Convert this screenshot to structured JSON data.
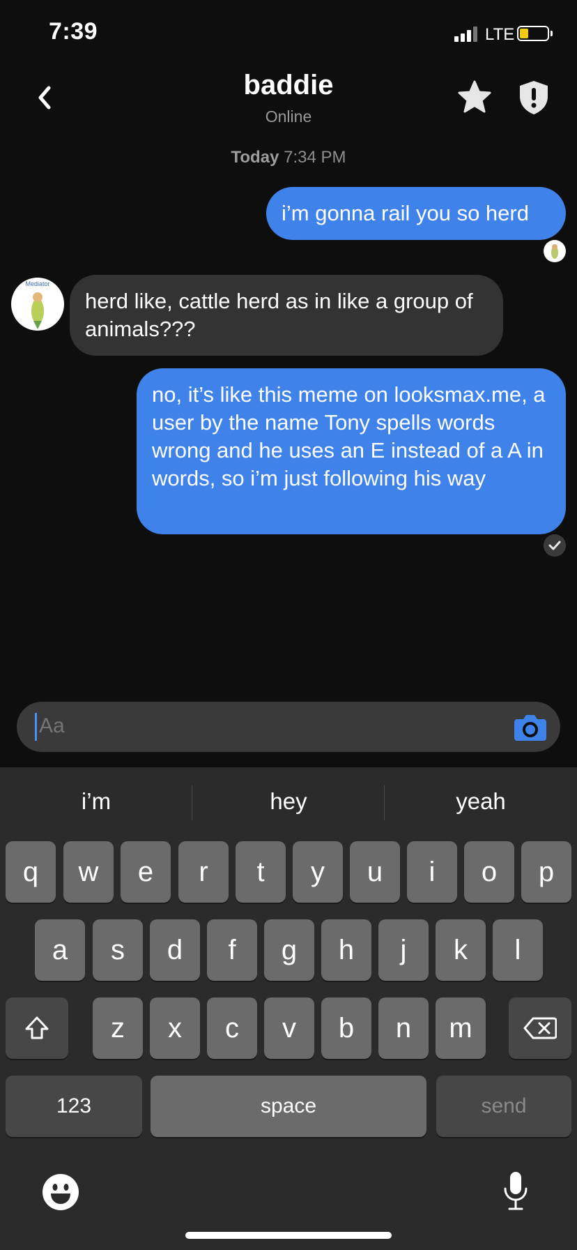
{
  "status_bar": {
    "time": "7:39",
    "network": "LTE"
  },
  "header": {
    "name": "baddie",
    "status": "Online"
  },
  "conversation": {
    "timestamp_day": "Today",
    "timestamp_time": "7:34 PM",
    "messages": [
      {
        "direction": "outgoing",
        "text": "i’m gonna rail you so herd"
      },
      {
        "direction": "incoming",
        "text": "herd like, cattle herd as in like a group of animals???"
      },
      {
        "direction": "outgoing",
        "text": "no, it’s like this meme on looksmax.me, a user by the name Tony spells words wrong and he uses an E instead of a A in words, so i’m just following his way"
      }
    ],
    "avatar_caption": "Mediator"
  },
  "composer": {
    "placeholder": "Aa"
  },
  "keyboard": {
    "suggestions": [
      "i’m",
      "hey",
      "yeah"
    ],
    "row1": [
      "q",
      "w",
      "e",
      "r",
      "t",
      "y",
      "u",
      "i",
      "o",
      "p"
    ],
    "row2": [
      "a",
      "s",
      "d",
      "f",
      "g",
      "h",
      "j",
      "k",
      "l"
    ],
    "row3": [
      "z",
      "x",
      "c",
      "v",
      "b",
      "n",
      "m"
    ],
    "numbers_key": "123",
    "space_key": "space",
    "send_key": "send"
  },
  "colors": {
    "outgoing_bubble": "#3f83ea",
    "incoming_bubble": "#333333",
    "background": "#0e0e0e",
    "keyboard": "#2b2b2b"
  }
}
